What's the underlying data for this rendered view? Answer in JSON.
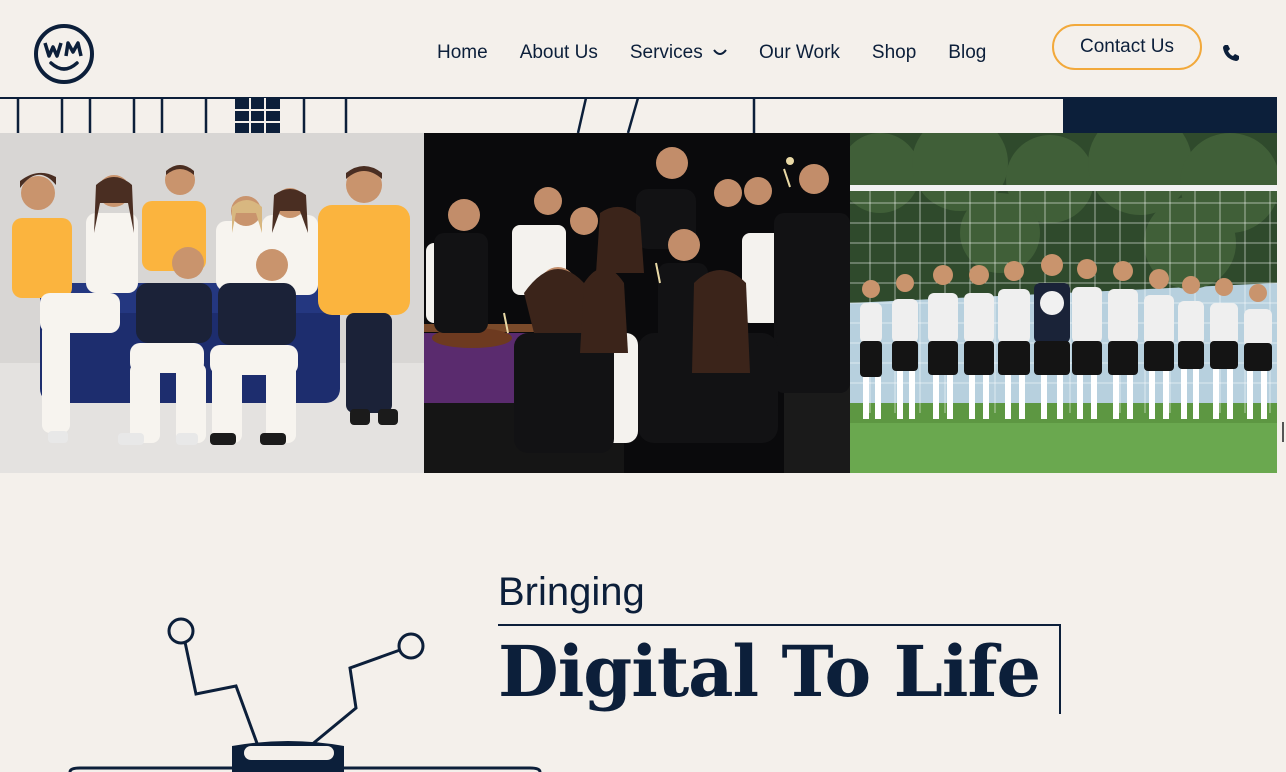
{
  "brand": {
    "logo_letters": "WM"
  },
  "nav": {
    "items": [
      {
        "label": "Home"
      },
      {
        "label": "About Us"
      },
      {
        "label": "Services"
      },
      {
        "label": "Our Work"
      },
      {
        "label": "Shop"
      },
      {
        "label": "Blog"
      }
    ],
    "contact_label": "Contact Us",
    "phone_icon": "phone-icon",
    "services_icon": "chevron-down-icon"
  },
  "hero": {
    "kicker": "Bringing",
    "headline": "Digital To Life"
  },
  "photos": [
    {
      "name": "team-casual-photo"
    },
    {
      "name": "team-casino-photo"
    },
    {
      "name": "team-soccer-photo"
    }
  ],
  "colors": {
    "navy": "#0c1f3a",
    "background": "#f4f0eb",
    "accent_orange": "#f2a93b",
    "shirt_yellow": "#fbb43e"
  }
}
